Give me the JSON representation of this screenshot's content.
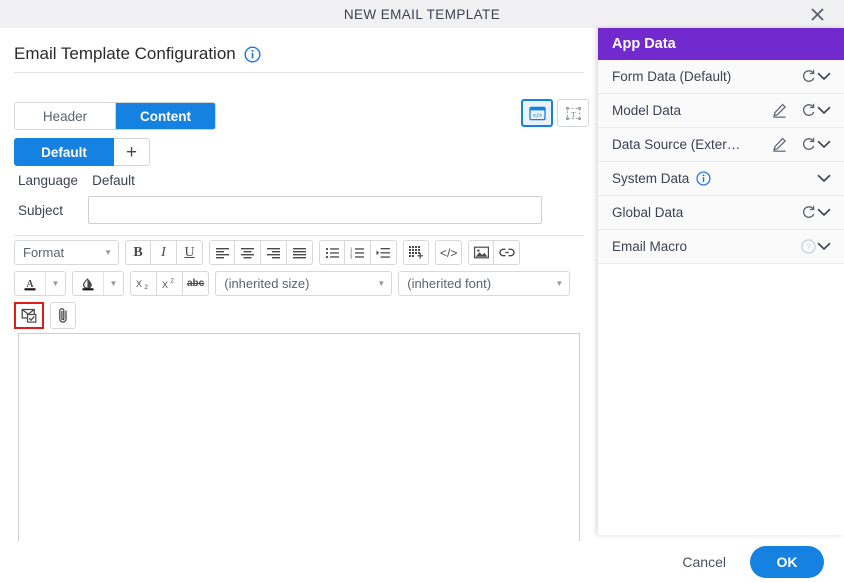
{
  "window": {
    "title": "NEW EMAIL TEMPLATE",
    "close_icon": "close-icon"
  },
  "config": {
    "page_title": "Email Template Configuration",
    "info_icon": "info-icon",
    "tabs": [
      {
        "label": "Header",
        "active": false
      },
      {
        "label": "Content",
        "active": true
      }
    ],
    "language_tabs": [
      {
        "label": "Default",
        "active": true
      }
    ],
    "add_language_label": "+",
    "language_field_label": "Language",
    "language_field_value": "Default",
    "subject_label": "Subject",
    "subject_value": "",
    "subject_placeholder": "",
    "view_toggle": [
      {
        "icon": "html-source-view-icon",
        "active": true
      },
      {
        "icon": "text-box-view-icon",
        "active": false
      }
    ]
  },
  "editor": {
    "format_select": "Format",
    "size_select": "(inherited size)",
    "font_select": "(inherited font)",
    "toolbar_row1": [
      {
        "icon": "bold-icon",
        "label": "B"
      },
      {
        "icon": "italic-icon",
        "label": "I"
      },
      {
        "icon": "underline-icon",
        "label": "U"
      },
      {
        "icon": "align-left-icon",
        "label": ""
      },
      {
        "icon": "align-center-icon",
        "label": ""
      },
      {
        "icon": "align-right-icon",
        "label": ""
      },
      {
        "icon": "align-justify-icon",
        "label": ""
      },
      {
        "icon": "bullet-list-icon",
        "label": ""
      },
      {
        "icon": "numbered-list-icon",
        "label": ""
      },
      {
        "icon": "indent-icon",
        "label": ""
      },
      {
        "icon": "insert-table-icon",
        "label": ""
      },
      {
        "icon": "source-code-icon",
        "label": ""
      },
      {
        "icon": "insert-image-icon",
        "label": ""
      },
      {
        "icon": "insert-link-icon",
        "label": ""
      }
    ],
    "toolbar_row2": [
      {
        "icon": "text-color-icon",
        "label": "A"
      },
      {
        "icon": "background-color-icon",
        "label": ""
      },
      {
        "icon": "subscript-icon",
        "label": "X"
      },
      {
        "icon": "superscript-icon",
        "label": "X"
      },
      {
        "icon": "strikethrough-icon",
        "label": "abc"
      }
    ],
    "toolbar_row3": [
      {
        "icon": "insert-email-macro-icon",
        "label": "",
        "highlighted": true
      },
      {
        "icon": "attachment-paperclip-icon",
        "label": "",
        "highlighted": false
      }
    ],
    "content": ""
  },
  "app_data": {
    "title": "App Data",
    "items": [
      {
        "label": "Form Data (Default)",
        "has_edit": false,
        "has_refresh": true,
        "has_info": false,
        "has_help": false,
        "chevron": "chevron-down-icon"
      },
      {
        "label": "Model Data",
        "has_edit": true,
        "has_refresh": true,
        "has_info": false,
        "has_help": false,
        "chevron": "chevron-down-icon"
      },
      {
        "label": "Data Source (Exter…",
        "has_edit": true,
        "has_refresh": true,
        "has_info": false,
        "has_help": false,
        "chevron": "chevron-down-icon"
      },
      {
        "label": "System Data",
        "has_edit": false,
        "has_refresh": false,
        "has_info": true,
        "has_help": false,
        "chevron": "chevron-down-icon"
      },
      {
        "label": "Global Data",
        "has_edit": false,
        "has_refresh": true,
        "has_info": false,
        "has_help": false,
        "chevron": "chevron-down-icon"
      },
      {
        "label": "Email Macro",
        "has_edit": false,
        "has_refresh": false,
        "has_info": false,
        "has_help": true,
        "chevron": "chevron-down-icon"
      }
    ]
  },
  "footer": {
    "cancel_label": "Cancel",
    "ok_label": "OK"
  },
  "colors": {
    "accent_blue": "#1581e0",
    "panel_purple": "#7229cd",
    "titlebar_gray": "#f1f1f3",
    "highlight_red": "#e01b1b",
    "info_blue": "#1a73e8"
  }
}
